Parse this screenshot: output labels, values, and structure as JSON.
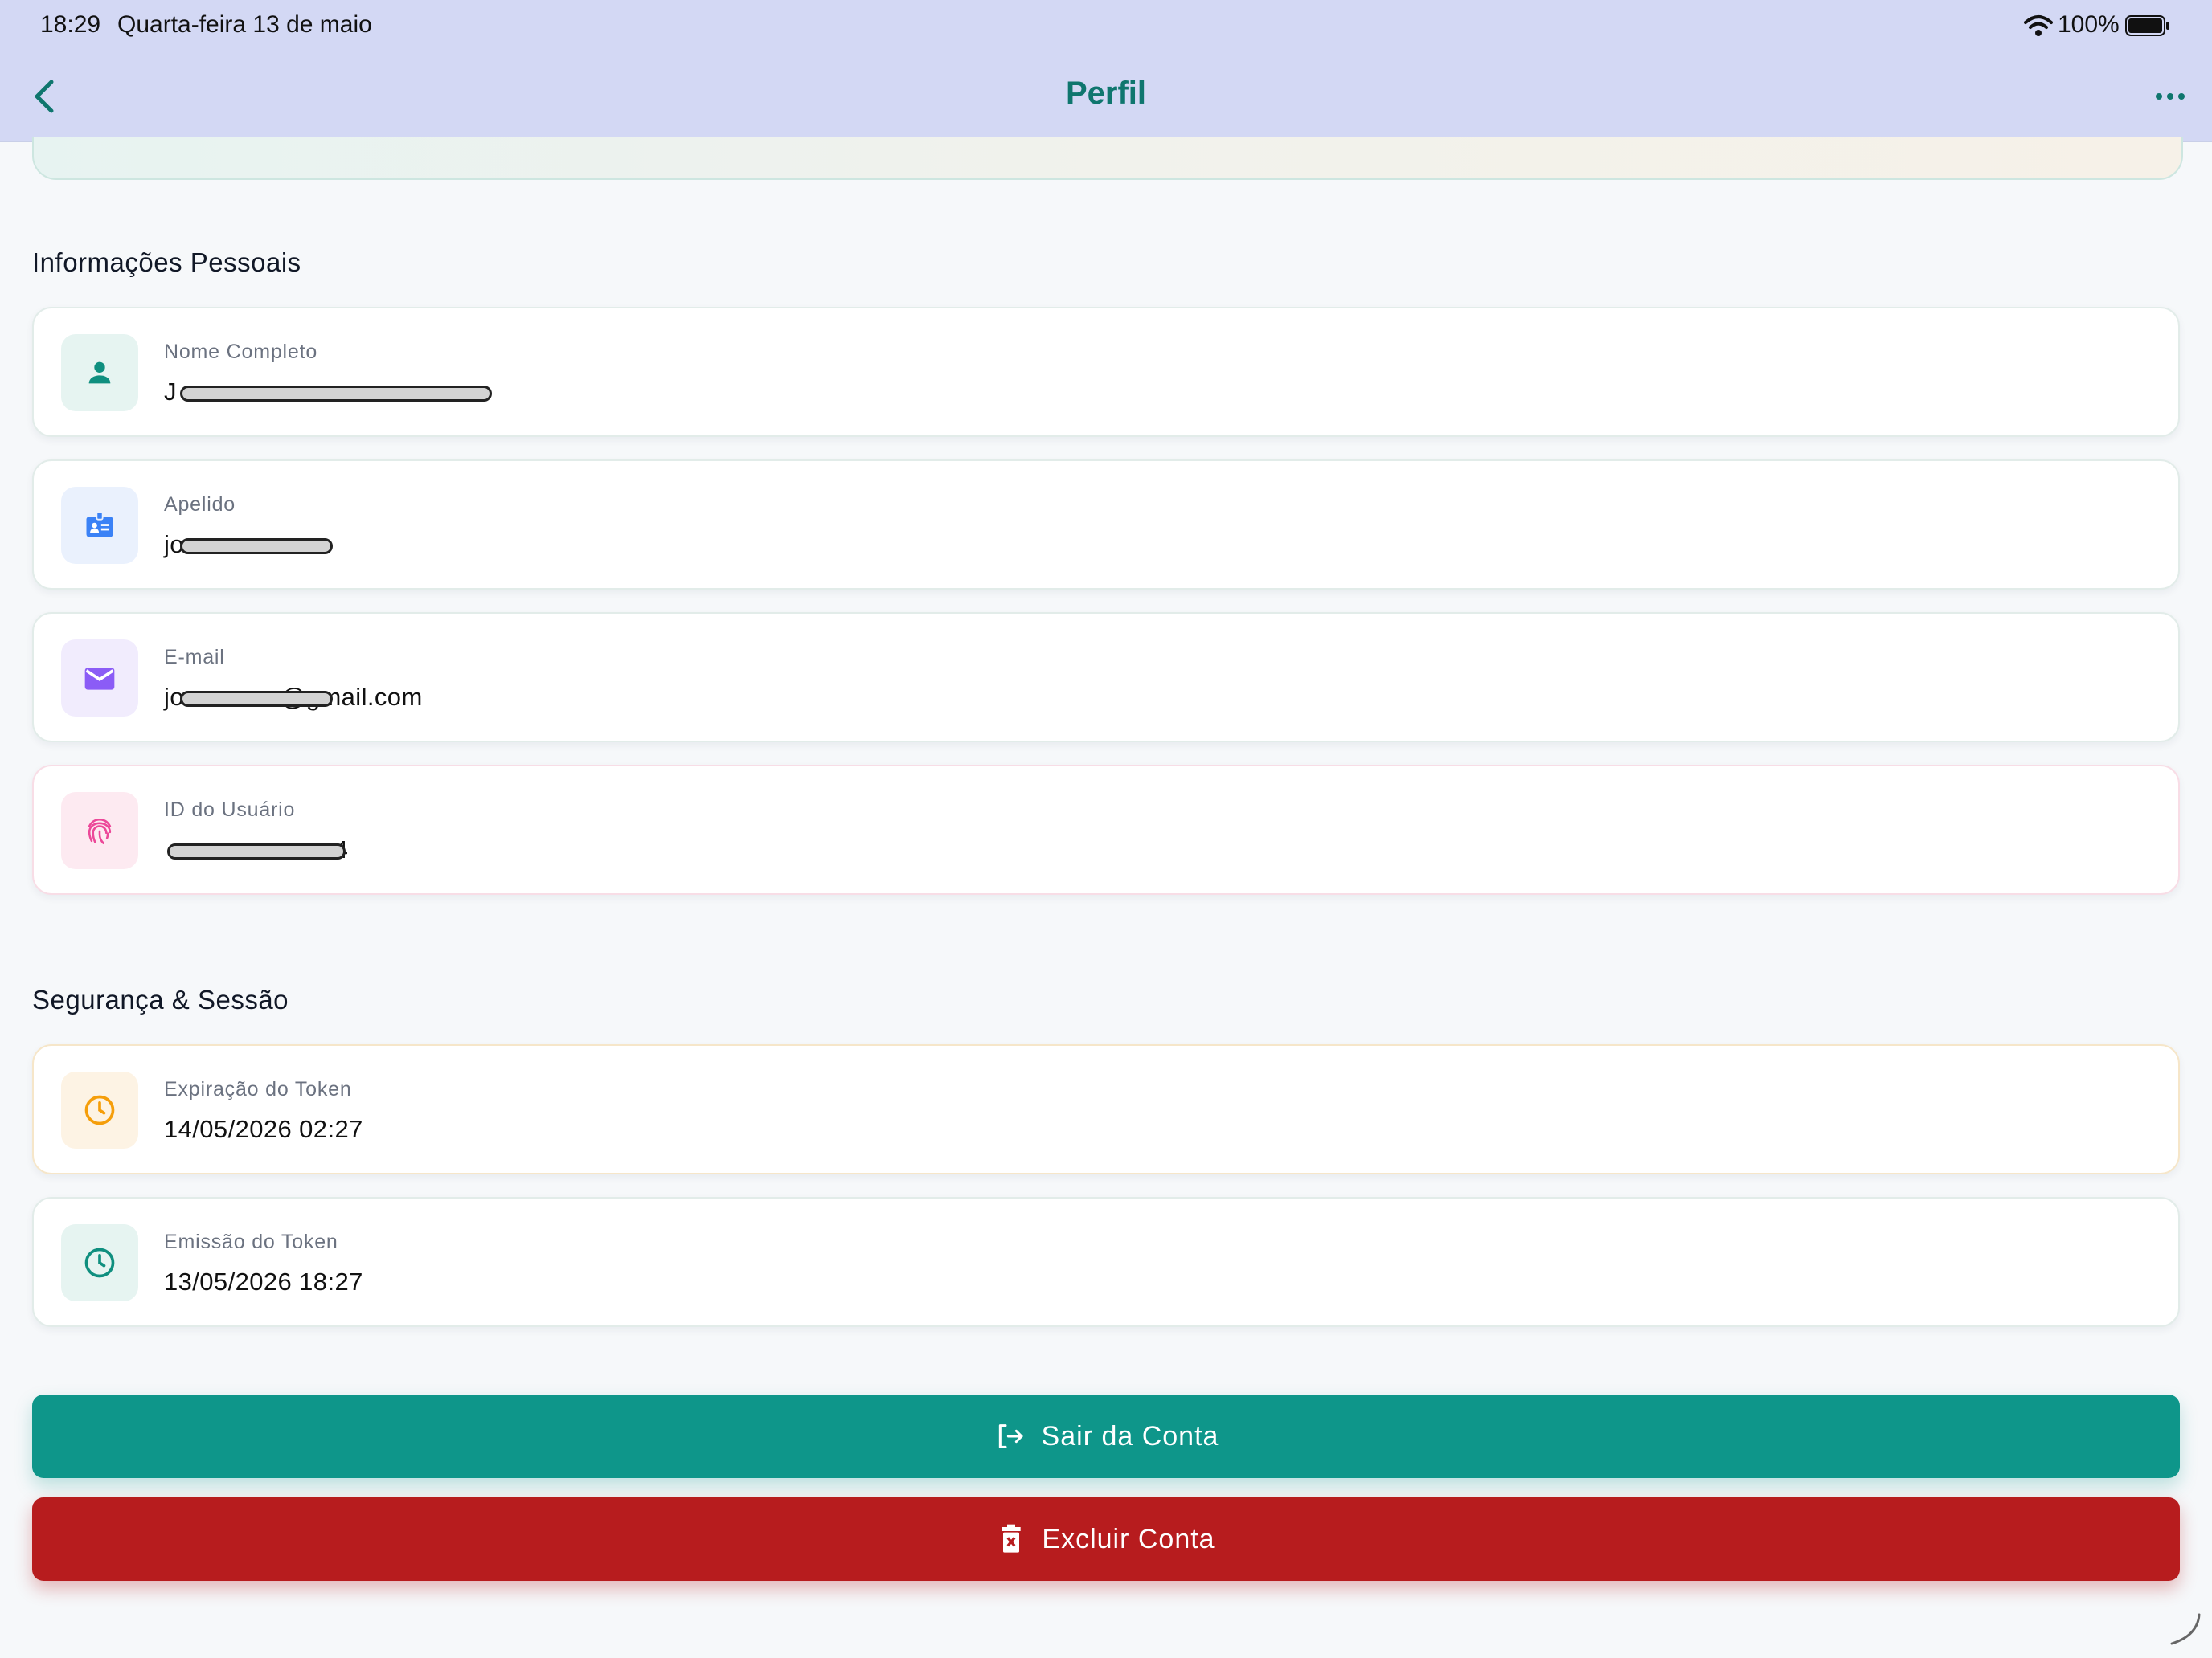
{
  "status_bar": {
    "time": "18:29",
    "date": "Quarta-feira 13 de maio",
    "battery": "100%"
  },
  "header": {
    "title": "Perfil",
    "back_icon": "chevron-left-icon",
    "more_icon": "more-horizontal-icon"
  },
  "personal_section": {
    "title": "Informações Pessoais",
    "fields": [
      {
        "label": "Nome Completo",
        "value": "J",
        "icon": "person-icon",
        "color": "#0f8f7f"
      },
      {
        "label": "Apelido",
        "value": "jo",
        "icon": "id-badge-icon",
        "color": "#3b82f6"
      },
      {
        "label": "E-mail",
        "value_prefix": "jo",
        "value_suffix": "@gmail.com",
        "icon": "mail-icon",
        "color": "#8b5cf6"
      },
      {
        "label": "ID do Usuário",
        "value": "a4",
        "icon": "fingerprint-icon",
        "color": "#ec4899"
      }
    ]
  },
  "security_section": {
    "title": "Segurança & Sessão",
    "fields": [
      {
        "label": "Expiração do Token",
        "value": "14/05/2026 02:27",
        "icon": "clock-icon",
        "color": "#f59e0b"
      },
      {
        "label": "Emissão do Token",
        "value": "13/05/2026 18:27",
        "icon": "clock-icon",
        "color": "#0f8f7f"
      }
    ]
  },
  "actions": {
    "logout_label": "Sair da Conta",
    "delete_label": "Excluir Conta",
    "logout_color": "#0e968a",
    "delete_color": "#b71c1e"
  }
}
